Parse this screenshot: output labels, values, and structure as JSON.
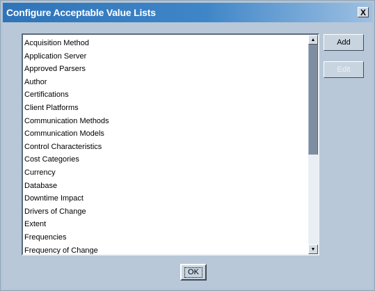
{
  "window": {
    "title": "Configure Acceptable Value Lists",
    "close_label": "X"
  },
  "list": {
    "items": [
      "Acquisition Method",
      "Application Server",
      "Approved Parsers",
      "Author",
      "Certifications",
      "Client Platforms",
      "Communication Methods",
      "Communication Models",
      "Control Characteristics",
      "Cost Categories",
      "Currency",
      "Database",
      "Downtime Impact",
      "Drivers of Change",
      "Extent",
      "Frequencies",
      "Frequency of Change"
    ],
    "scroll_up_icon": "scroll-up-arrow",
    "scroll_down_icon": "scroll-down-arrow"
  },
  "buttons": {
    "add_label": "Add",
    "edit_label": "Edit",
    "ok_label": "OK"
  },
  "colors": {
    "titlebar_start": "#2f74b8",
    "titlebar_end": "#9ec0e2",
    "dialog_bg": "#b8c8d8",
    "disabled_text": "#edf2f7"
  }
}
